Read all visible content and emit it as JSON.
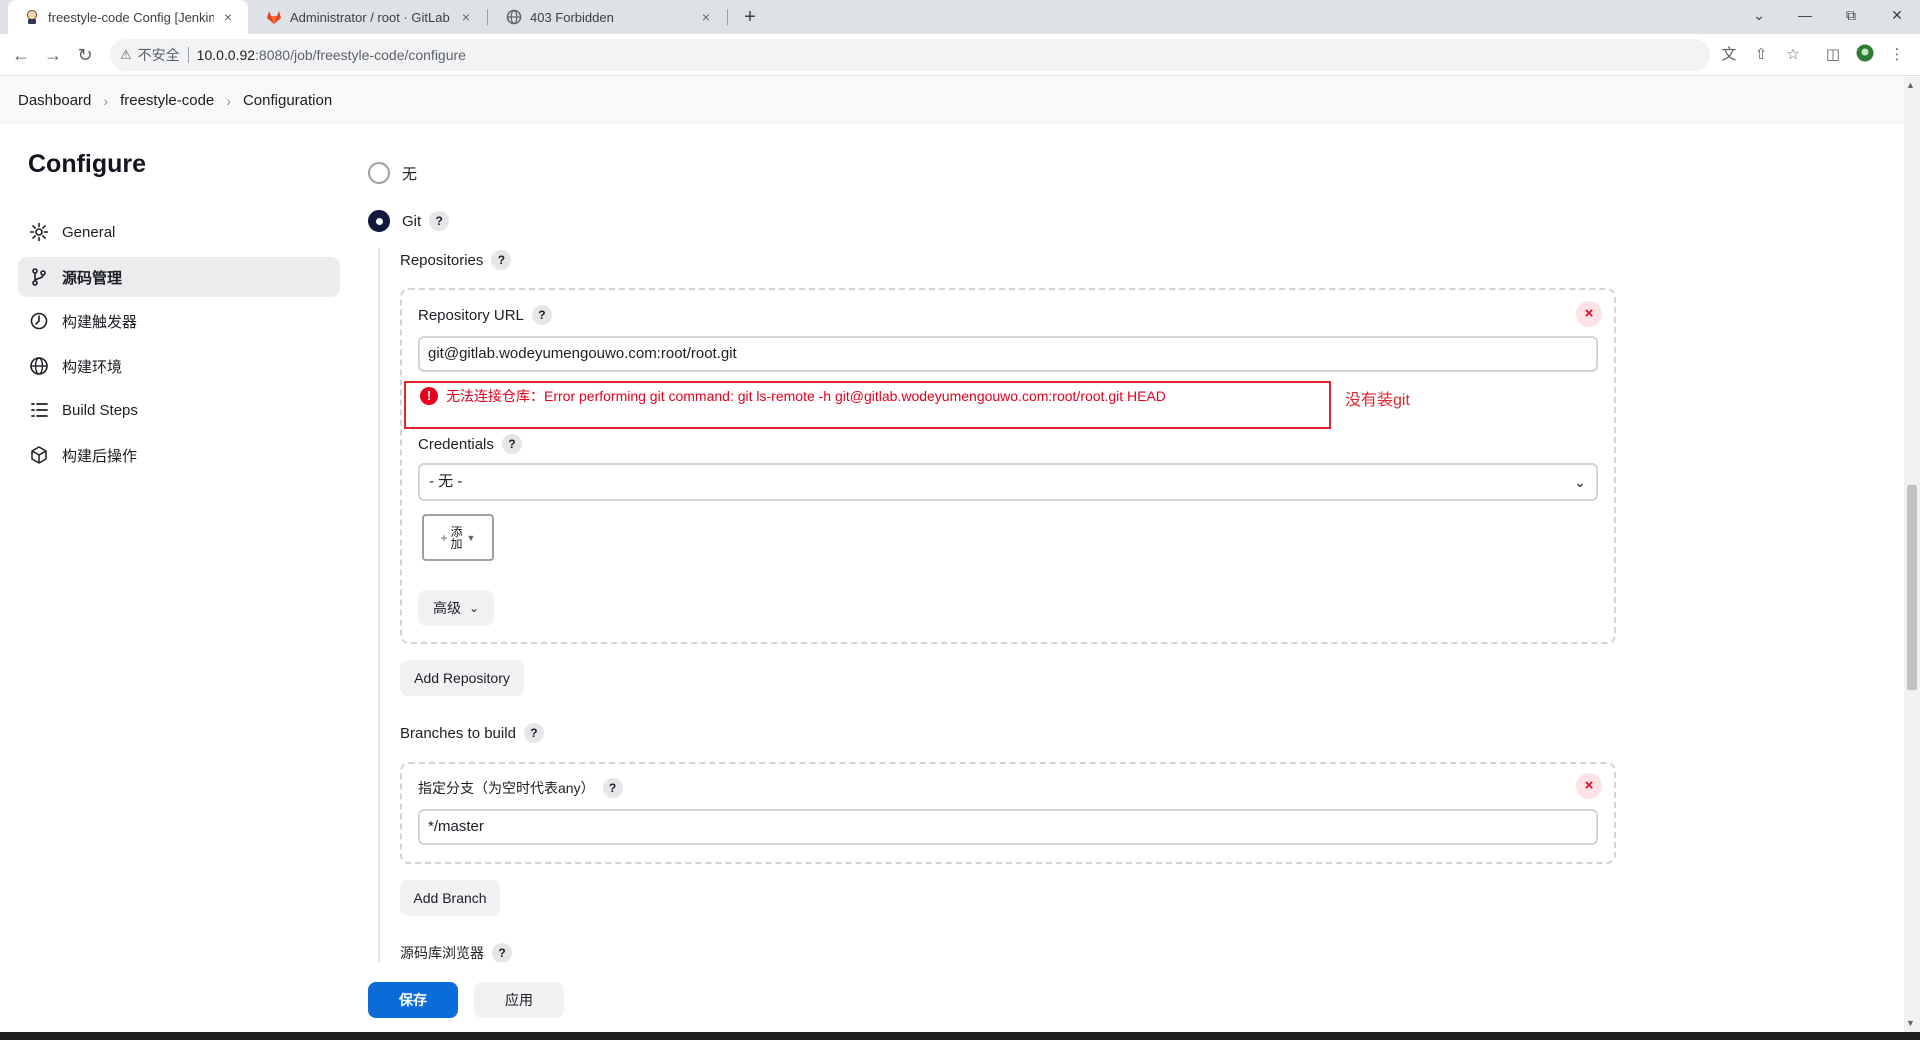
{
  "browser": {
    "tabs": [
      {
        "title": "freestyle-code Config [Jenkins]",
        "active": true,
        "icon": "jenkins-icon"
      },
      {
        "title": "Administrator / root · GitLab",
        "active": false,
        "icon": "gitlab-icon"
      },
      {
        "title": "403 Forbidden",
        "active": false,
        "icon": "globe-icon"
      }
    ],
    "tab_close": "×",
    "new_tab": "+",
    "security_label": "不安全",
    "url_host": "10.0.0.92",
    "url_path": ":8080/job/freestyle-code/configure"
  },
  "breadcrumb": [
    "Dashboard",
    "freestyle-code",
    "Configuration"
  ],
  "sidebar": {
    "title": "Configure",
    "items": [
      {
        "label": "General",
        "icon": "gear-icon",
        "active": false
      },
      {
        "label": "源码管理",
        "icon": "branch-icon",
        "active": true
      },
      {
        "label": "构建触发器",
        "icon": "clock-icon",
        "active": false
      },
      {
        "label": "构建环境",
        "icon": "globe-icon",
        "active": false
      },
      {
        "label": "Build Steps",
        "icon": "list-icon",
        "active": false
      },
      {
        "label": "构建后操作",
        "icon": "cube-icon",
        "active": false
      }
    ]
  },
  "scm": {
    "option_none": "无",
    "option_git": "Git",
    "help": "?",
    "repositories_label": "Repositories",
    "repo_url_label": "Repository URL",
    "repo_url_value": "git@gitlab.wodeyumengouwo.com:root/root.git",
    "error_text": "无法连接仓库：Error performing git command: git ls-remote -h git@gitlab.wodeyumengouwo.com:root/root.git HEAD",
    "annotation": "没有装git",
    "credentials_label": "Credentials",
    "credentials_value": "- 无 -",
    "add_button": "添加",
    "advanced_button": "高级",
    "add_repository": "Add Repository",
    "branches_label": "Branches to build",
    "branch_spec_label": "指定分支（为空时代表any）",
    "branch_spec_value": "*/master",
    "add_branch": "Add Branch",
    "repo_browser_label": "源码库浏览器",
    "delete": "×"
  },
  "actions": {
    "save": "保存",
    "apply": "应用"
  },
  "colors": {
    "primary": "#0b6bd8",
    "error": "#e6001e",
    "radio_selected": "#13183d"
  }
}
